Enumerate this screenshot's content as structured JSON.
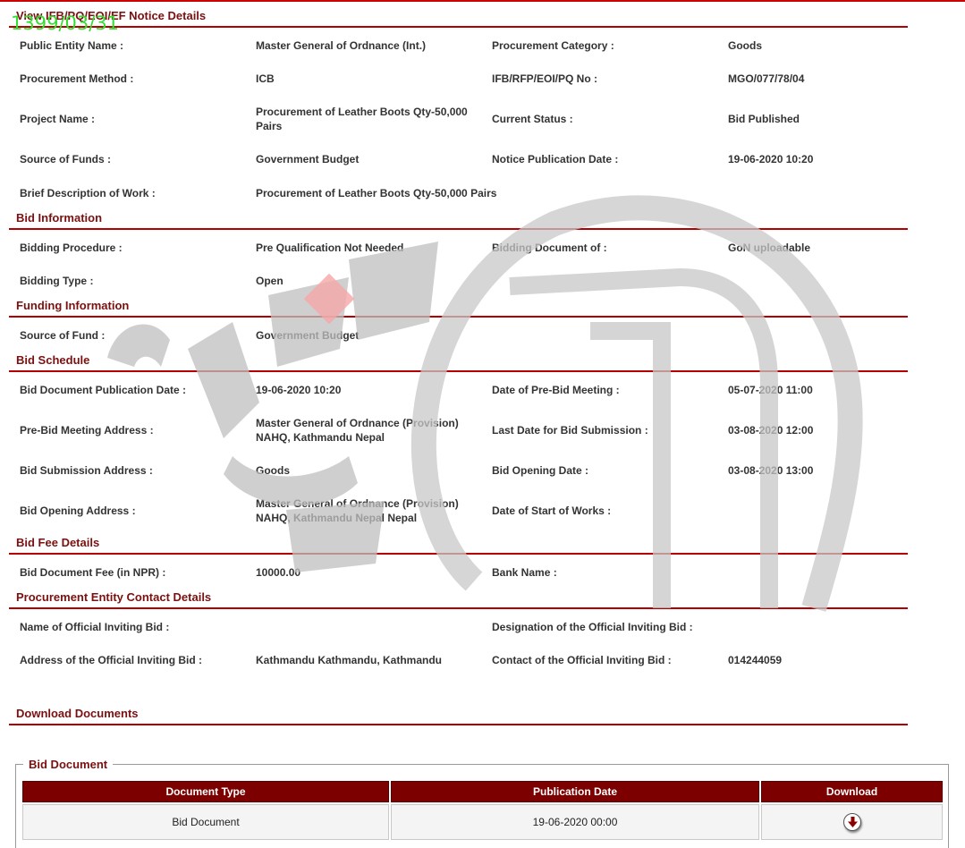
{
  "stamp": "1399/03/31",
  "page_title": "View IFB/PQ/EOI/EF Notice Details",
  "notice": {
    "public_entity_label": "Public Entity Name :",
    "public_entity_value": "Master General of Ordnance (Int.)",
    "procurement_category_label": "Procurement Category :",
    "procurement_category_value": "Goods",
    "procurement_method_label": "Procurement Method :",
    "procurement_method_value": "ICB",
    "ifb_no_label": "IFB/RFP/EOI/PQ No :",
    "ifb_no_value": "MGO/077/78/04",
    "project_name_label": "Project Name :",
    "project_name_value_line1": "Procurement of Leather Boots Qty-50,000",
    "project_name_value_line2": "Pairs",
    "current_status_label": "Current Status :",
    "current_status_value": "Bid Published",
    "source_of_funds_label": "Source of Funds :",
    "source_of_funds_value": "Government Budget",
    "notice_pub_date_label": "Notice Publication Date :",
    "notice_pub_date_value": "19-06-2020 10:20",
    "brief_desc_label": "Brief Description of Work :",
    "brief_desc_value": "Procurement of Leather Boots Qty-50,000 Pairs"
  },
  "bid_information": {
    "title": "Bid Information",
    "bidding_procedure_label": "Bidding Procedure :",
    "bidding_procedure_value": "Pre Qualification Not Needed",
    "bidding_document_of_label": "Bidding Document of :",
    "bidding_document_of_value": "GoN uploadable",
    "bidding_type_label": "Bidding Type :",
    "bidding_type_value": "Open"
  },
  "funding_information": {
    "title": "Funding Information",
    "source_of_fund_label": "Source of Fund :",
    "source_of_fund_value": "Government Budget"
  },
  "bid_schedule": {
    "title": "Bid Schedule",
    "doc_pub_date_label": "Bid Document Publication Date :",
    "doc_pub_date_value": "19-06-2020 10:20",
    "pre_bid_meeting_date_label": "Date of Pre-Bid Meeting :",
    "pre_bid_meeting_date_value": "05-07-2020 11:00",
    "pre_bid_address_label": "Pre-Bid Meeting Address :",
    "pre_bid_address_line1": "Master General of Ordnance (Provision)",
    "pre_bid_address_line2": "NAHQ, Kathmandu Nepal",
    "last_date_label": "Last Date for Bid Submission :",
    "last_date_value": "03-08-2020 12:00",
    "submission_address_label": "Bid Submission Address :",
    "submission_address_value": "Goods",
    "opening_date_label": "Bid Opening Date :",
    "opening_date_value": "03-08-2020 13:00",
    "opening_address_label": "Bid Opening Address :",
    "opening_address_line1": "Master General of Ordnance (Provision)",
    "opening_address_line2": "NAHQ, Kathmandu Nepal Nepal",
    "start_of_works_label": "Date of Start of Works :"
  },
  "bid_fee": {
    "title": "Bid Fee Details",
    "doc_fee_label": "Bid Document Fee (in NPR) :",
    "doc_fee_value": "10000.00",
    "bank_name_label": "Bank Name :"
  },
  "contact": {
    "title": "Procurement Entity Contact Details",
    "official_name_label": "Name of Official Inviting Bid :",
    "designation_label": "Designation of the Official Inviting Bid :",
    "address_label": "Address of the Official Inviting Bid :",
    "address_value": "Kathmandu Kathmandu, Kathmandu",
    "contact_label": "Contact of the Official Inviting Bid :",
    "contact_value": "014244059"
  },
  "downloads": {
    "title": "Download Documents",
    "box_legend": "Bid Document",
    "columns": [
      "Document Type",
      "Publication Date",
      "Download"
    ],
    "rows": [
      {
        "document_type": "Bid Document",
        "publication_date": "19-06-2020 00:00",
        "download_icon": "download-arrow-icon"
      }
    ]
  },
  "colors": {
    "accent": "#b40000",
    "section_title": "#7a1010",
    "header_bg": "#7d0000",
    "stamp": "#33dd33"
  }
}
